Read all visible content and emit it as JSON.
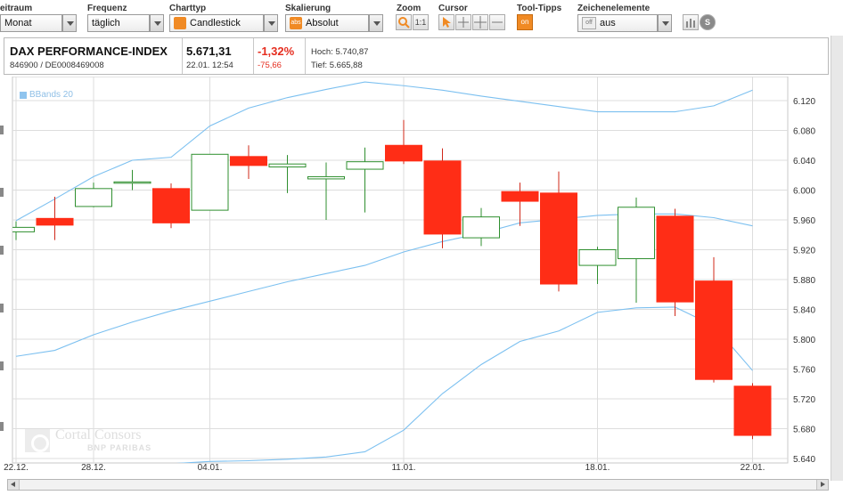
{
  "toolbar": {
    "zeitraum_label": "eitraum",
    "zeitraum_value": "Monat",
    "frequenz_label": "Frequenz",
    "frequenz_value": "täglich",
    "charttyp_label": "Charttyp",
    "charttyp_value": "Candlestick",
    "skalierung_label": "Skalierung",
    "skalierung_value": "Absolut",
    "skalierung_icon_text": "abs",
    "zoom_label": "Zoom",
    "zoom_reset_text": "1:1",
    "cursor_label": "Cursor",
    "tooltips_label": "Tool-Tipps",
    "tooltips_value": "on",
    "zeichen_label": "Zeichenelemente",
    "zeichen_value": "aus",
    "zeichen_toggle_text": "off",
    "settings_text": "S"
  },
  "quote": {
    "name": "DAX PERFORMANCE-INDEX",
    "isin": "846900 / DE0008469008",
    "price": "5.671,31",
    "datetime": "22.01. 12:54",
    "change_pct": "-1,32%",
    "change_abs": "-75,66",
    "high": "Hoch: 5.740,87",
    "low": "Tief: 5.665,88"
  },
  "watermark": {
    "name": "Cortal Consors",
    "sub": "BNP PARIBAS"
  },
  "colors": {
    "bull": "#2f8f2f",
    "bear": "#ff2d16",
    "band": "#7cc0f0",
    "grid": "#dddddd",
    "accent": "#f08a24"
  },
  "chart_data": {
    "type": "candlestick",
    "legend": [
      "BBands 20"
    ],
    "legend_position": "top-left",
    "grid": true,
    "ylim": [
      5640,
      6140
    ],
    "y_ticks": [
      "6.120",
      "6.080",
      "6.040",
      "6.000",
      "5.960",
      "5.920",
      "5.880",
      "5.840",
      "5.800",
      "5.760",
      "5.720",
      "5.680",
      "5.640"
    ],
    "y_tick_values": [
      6120,
      6080,
      6040,
      6000,
      5960,
      5920,
      5880,
      5840,
      5800,
      5760,
      5720,
      5680,
      5640
    ],
    "x_ticks": [
      {
        "label": "22.12.",
        "index": 0
      },
      {
        "label": "28.12.",
        "index": 2
      },
      {
        "label": "04.01.",
        "index": 5
      },
      {
        "label": "11.01.",
        "index": 10
      },
      {
        "label": "18.01.",
        "index": 15
      },
      {
        "label": "22.01.",
        "index": 19
      }
    ],
    "candles": [
      {
        "o": 5944,
        "h": 5958,
        "l": 5933,
        "c": 5950
      },
      {
        "o": 5962,
        "h": 5991,
        "l": 5933,
        "c": 5953
      },
      {
        "o": 5978,
        "h": 6010,
        "l": 5977,
        "c": 6002
      },
      {
        "o": 6011,
        "h": 6027,
        "l": 6000,
        "c": 6011
      },
      {
        "o": 6002,
        "h": 6009,
        "l": 5949,
        "c": 5956
      },
      {
        "o": 5973,
        "h": 6048,
        "l": 5973,
        "c": 6048
      },
      {
        "o": 6045,
        "h": 6060,
        "l": 6015,
        "c": 6033
      },
      {
        "o": 6031,
        "h": 6047,
        "l": 5996,
        "c": 6035
      },
      {
        "o": 6015,
        "h": 6037,
        "l": 5960,
        "c": 6018
      },
      {
        "o": 6028,
        "h": 6057,
        "l": 5970,
        "c": 6038
      },
      {
        "o": 6060,
        "h": 6094,
        "l": 6035,
        "c": 6039
      },
      {
        "o": 6039,
        "h": 6056,
        "l": 5922,
        "c": 5941
      },
      {
        "o": 5936,
        "h": 5976,
        "l": 5925,
        "c": 5964
      },
      {
        "o": 5998,
        "h": 6010,
        "l": 5952,
        "c": 5985
      },
      {
        "o": 5996,
        "h": 6025,
        "l": 5864,
        "c": 5874
      },
      {
        "o": 5899,
        "h": 5924,
        "l": 5874,
        "c": 5920
      },
      {
        "o": 5908,
        "h": 5990,
        "l": 5849,
        "c": 5977
      },
      {
        "o": 5965,
        "h": 5975,
        "l": 5831,
        "c": 5850
      },
      {
        "o": 5878,
        "h": 5910,
        "l": 5742,
        "c": 5746
      },
      {
        "o": 5737,
        "h": 5741,
        "l": 5666,
        "c": 5671
      }
    ],
    "band_upper": [
      5959,
      5988,
      6018,
      6040,
      6044,
      6086,
      6110,
      6124,
      6135,
      6145,
      6140,
      6134,
      6126,
      6119,
      6112,
      6105,
      6105,
      6105,
      6113,
      6134
    ],
    "band_middle": [
      5777,
      5785,
      5806,
      5823,
      5838,
      5851,
      5864,
      5877,
      5888,
      5899,
      5917,
      5931,
      5942,
      5956,
      5961,
      5966,
      5968,
      5968,
      5963,
      5952
    ],
    "band_lower": [
      5591,
      5582,
      5600,
      5617,
      5633,
      5636,
      5637,
      5639,
      5642,
      5649,
      5678,
      5727,
      5766,
      5797,
      5811,
      5836,
      5842,
      5843,
      5818,
      5758
    ]
  }
}
